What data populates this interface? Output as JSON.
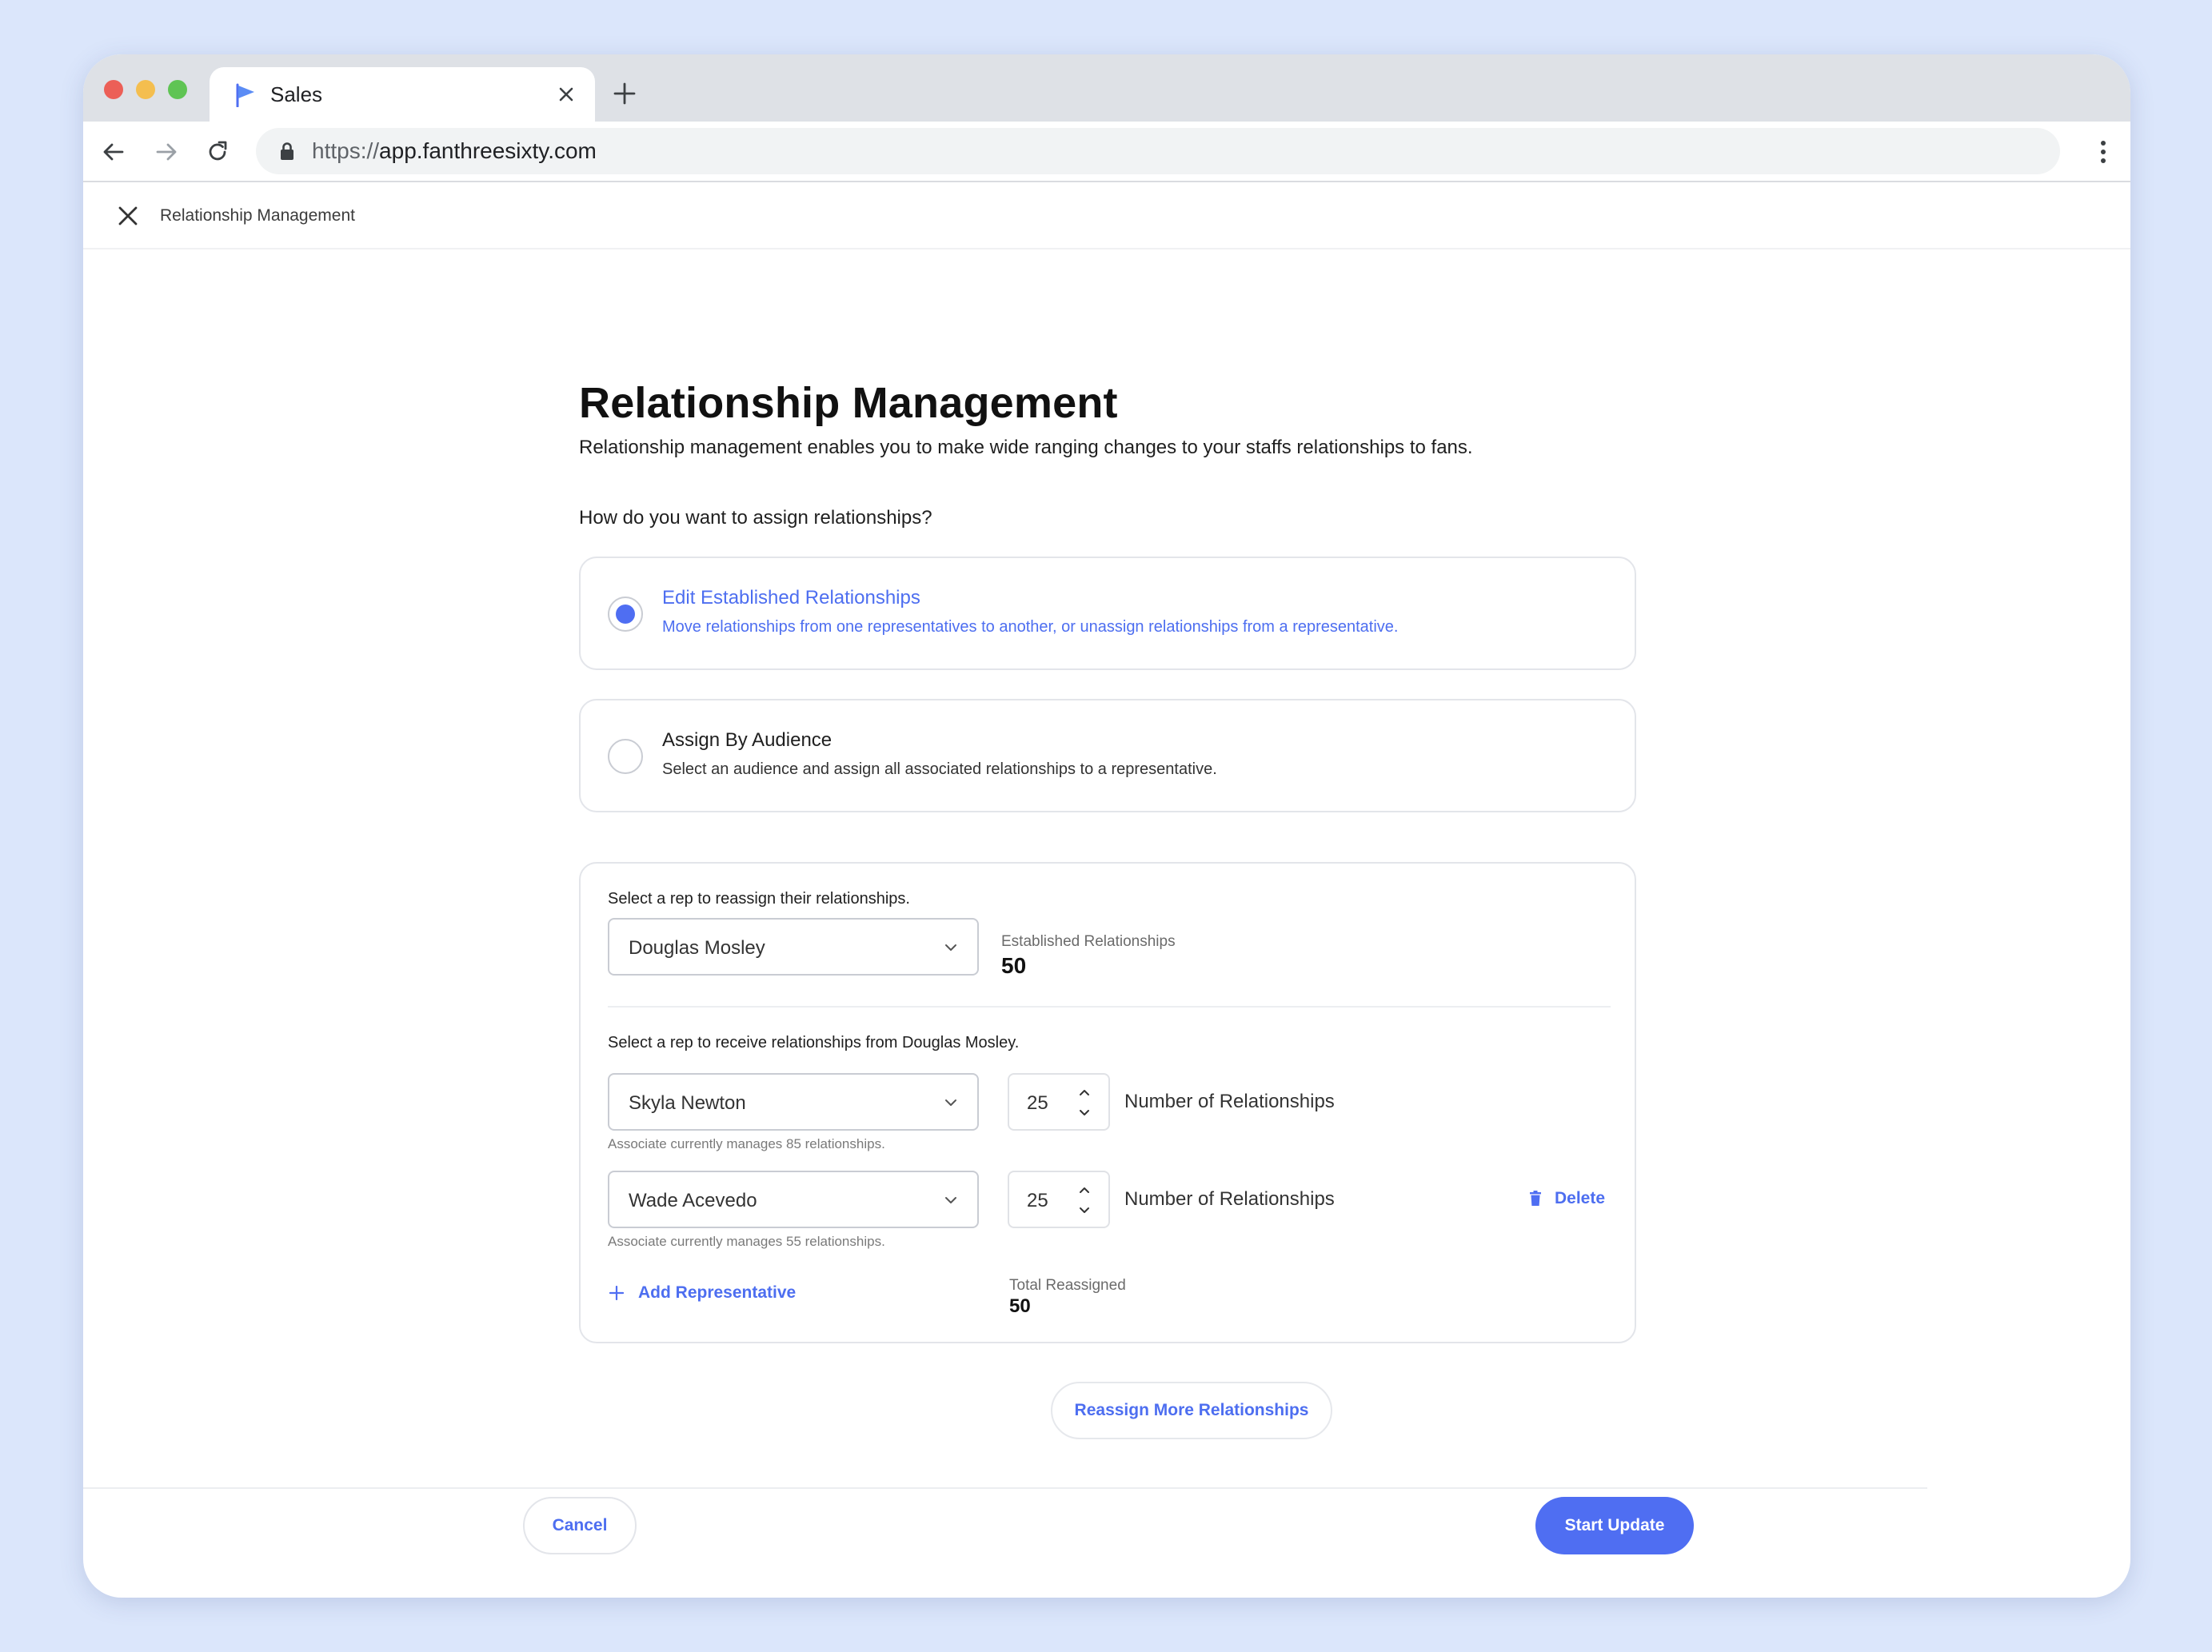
{
  "browser": {
    "tab_title": "Sales",
    "url_scheme": "https://",
    "url_host": "app.fanthreesixty.com"
  },
  "app_header": {
    "breadcrumb": "Relationship Management"
  },
  "page": {
    "title": "Relationship Management",
    "description": "Relationship management enables you to make wide ranging changes to your staffs relationships to fans.",
    "question": "How do you want to assign relationships?"
  },
  "options": [
    {
      "title": "Edit Established Relationships",
      "description": "Move relationships from one representatives to another, or unassign relationships from a representative.",
      "selected": true
    },
    {
      "title": "Assign By Audience",
      "description": "Select an audience and assign all associated relationships to a representative.",
      "selected": false
    }
  ],
  "reassign": {
    "source_label": "Select a rep to reassign their relationships.",
    "source_rep": "Douglas Mosley",
    "established_label": "Established Relationships",
    "established_value": "50",
    "receive_label": "Select a rep to receive relationships from Douglas Mosley.",
    "recipients": [
      {
        "rep": "Skyla Newton",
        "count": "25",
        "count_label": "Number of Relationships",
        "hint": "Associate currently manages 85 relationships."
      },
      {
        "rep": "Wade Acevedo",
        "count": "25",
        "count_label": "Number of Relationships",
        "hint": "Associate currently manages 55 relationships.",
        "delete_label": "Delete"
      }
    ],
    "add_rep_label": "Add Representative",
    "total_label": "Total Reassigned",
    "total_value": "50"
  },
  "reassign_more_label": "Reassign More Relationships",
  "footer": {
    "cancel_label": "Cancel",
    "start_label": "Start Update"
  },
  "colors": {
    "accent": "#4f6ef2",
    "page_bg": "#dbe6fb",
    "tabstrip": "#dee1e6"
  },
  "icons": {
    "tab": "flag-icon",
    "close": "close-icon",
    "new_tab": "plus-icon",
    "back": "arrow-left-icon",
    "forward": "arrow-right-icon",
    "reload": "reload-icon",
    "lock": "lock-icon",
    "menu": "kebab-menu-icon",
    "dropdown": "chevron-down-icon",
    "stepper": "stepper-arrows-icon",
    "delete": "trash-icon",
    "add": "plus-icon"
  }
}
